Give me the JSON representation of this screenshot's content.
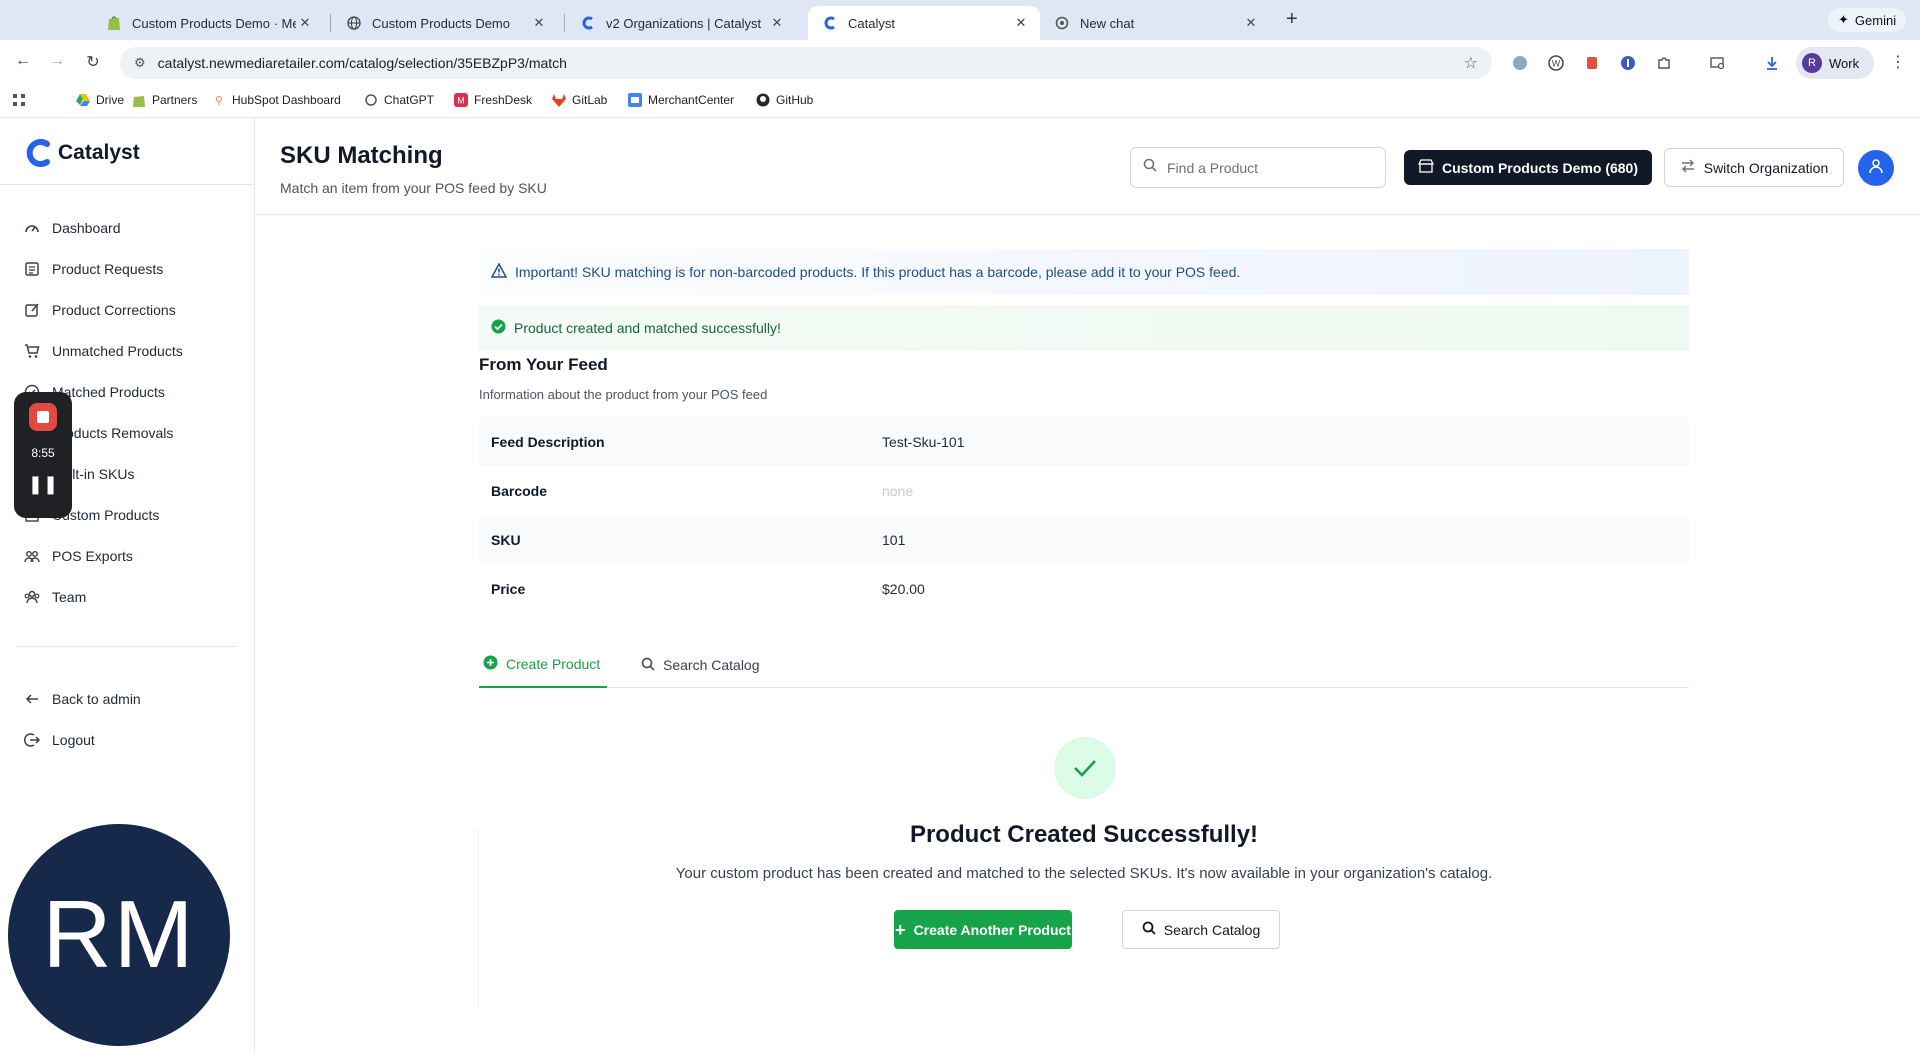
{
  "browser": {
    "tabs": [
      {
        "label": "Custom Products Demo · Me",
        "active": false
      },
      {
        "label": "Custom Products Demo",
        "active": false
      },
      {
        "label": "v2 Organizations | Catalyst",
        "active": false
      },
      {
        "label": "Catalyst",
        "active": true
      },
      {
        "label": "New chat",
        "active": false
      }
    ],
    "gemini_label": "Gemini",
    "url": "catalyst.newmediaretailer.com/catalog/selection/35EBZpP3/match",
    "profile_initial": "R",
    "profile_label": "Work",
    "bookmarks": [
      "Drive",
      "Partners",
      "HubSpot Dashboard",
      "ChatGPT",
      "FreshDesk",
      "GitLab",
      "MerchantCenter",
      "GitHub"
    ]
  },
  "recorder": {
    "time": "8:55"
  },
  "webcam": {
    "initials": "RM"
  },
  "sidebar": {
    "brand": "Catalyst",
    "items": [
      {
        "label": "Dashboard",
        "icon": "dashboard-icon"
      },
      {
        "label": "Product Requests",
        "icon": "list-icon"
      },
      {
        "label": "Product Corrections",
        "icon": "edit-icon"
      },
      {
        "label": "Unmatched Products",
        "icon": "cart-icon"
      },
      {
        "label": "Matched Products",
        "icon": "check-circle-icon"
      },
      {
        "label": "Products Removals",
        "icon": "trash-icon"
      },
      {
        "label": "Built-in SKUs",
        "icon": "tag-icon"
      },
      {
        "label": "Custom Products",
        "icon": "box-icon"
      },
      {
        "label": "POS Exports",
        "icon": "users-icon"
      },
      {
        "label": "Team",
        "icon": "team-icon"
      }
    ],
    "back_label": "Back to admin",
    "logout_label": "Logout"
  },
  "header": {
    "title": "SKU Matching",
    "subtitle": "Match an item from your POS feed by SKU",
    "search_placeholder": "Find a Product",
    "org_label": "Custom Products Demo (680)",
    "switch_label": "Switch Organization"
  },
  "alerts": {
    "info": "Important! SKU matching is for non-barcoded products. If this product has a barcode, please add it to your POS feed.",
    "success": "Product created and matched successfully!"
  },
  "feed": {
    "title": "From Your Feed",
    "subtitle": "Information about the product from your POS feed",
    "rows": [
      {
        "label": "Feed Description",
        "value": "Test-Sku-101",
        "muted": false
      },
      {
        "label": "Barcode",
        "value": "none",
        "muted": true
      },
      {
        "label": "SKU",
        "value": "101",
        "muted": false
      },
      {
        "label": "Price",
        "value": "$20.00",
        "muted": false
      }
    ]
  },
  "tabs": {
    "create": "Create Product",
    "search": "Search Catalog",
    "active": "create"
  },
  "result": {
    "title": "Product Created Successfully!",
    "description": "Your custom product has been created and matched to the selected SKUs. It's now available in your organization's catalog.",
    "create_another": "Create Another Product",
    "search_catalog": "Search Catalog"
  },
  "colors": {
    "accent_green": "#16a34a",
    "dark_button": "#111827",
    "avatar_blue": "#2563eb",
    "info_text": "#1e4e8c"
  }
}
